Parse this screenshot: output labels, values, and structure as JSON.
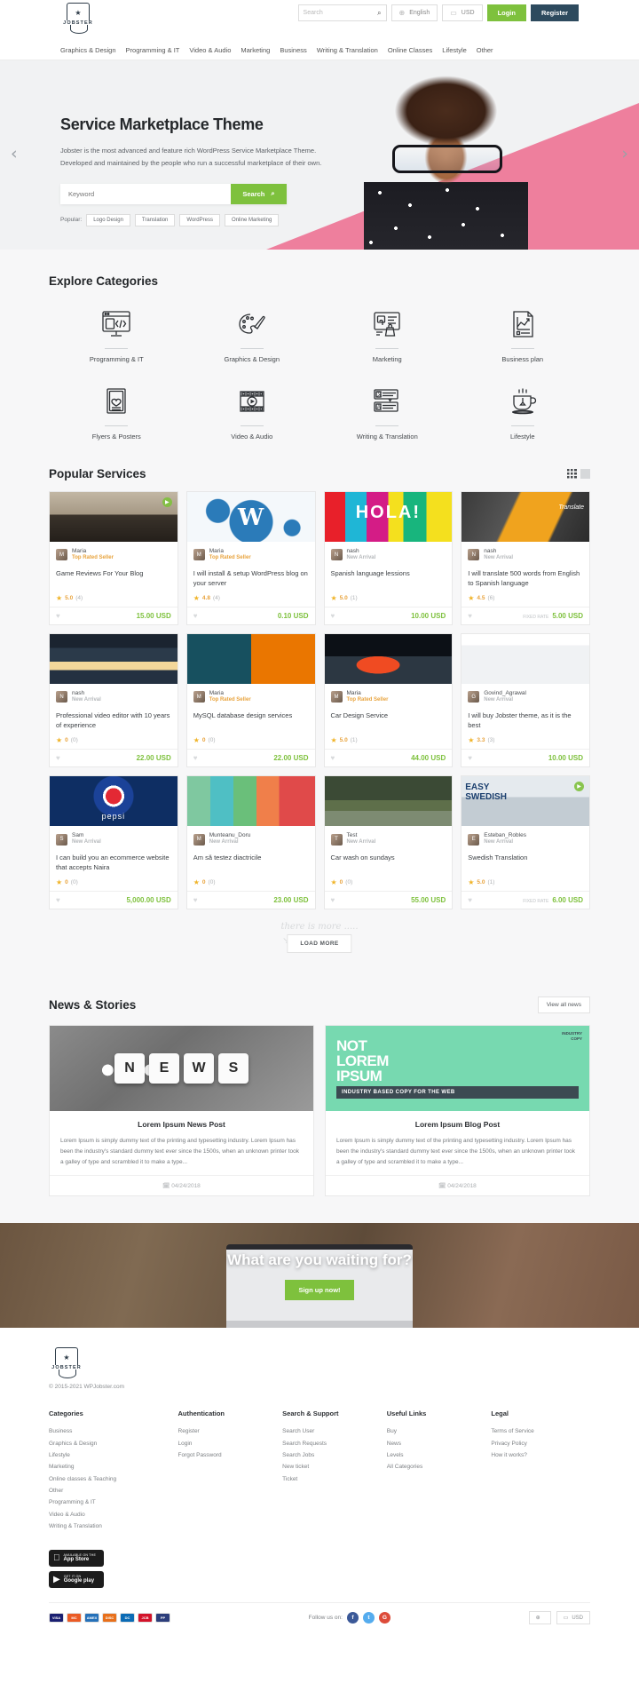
{
  "header": {
    "logo_text": "JOBSTER",
    "search_placeholder": "Search",
    "language": "English",
    "currency": "USD",
    "login_label": "Login",
    "register_label": "Register",
    "nav": [
      "Graphics & Design",
      "Programming & IT",
      "Video & Audio",
      "Marketing",
      "Business",
      "Writing & Translation",
      "Online Classes",
      "Lifestyle",
      "Other"
    ]
  },
  "hero": {
    "title": "Service Marketplace Theme",
    "subtitle_line1": "Jobster is the most advanced and feature rich WordPress Service Marketplace Theme.",
    "subtitle_line2": "Developed and maintained by the people who run a successful marketplace of their own.",
    "search_placeholder": "Keyword",
    "search_button": "Search",
    "popular_label": "Popular:",
    "popular_tags": [
      "Logo Design",
      "Translation",
      "WordPress",
      "Online Marketing"
    ],
    "prev_icon": "chevron-left",
    "next_icon": "chevron-right",
    "pink_color": "#ee7f9d"
  },
  "categories": {
    "title": "Explore Categories",
    "items": [
      {
        "label": "Programming & IT",
        "icon": "monitor-code-icon"
      },
      {
        "label": "Graphics & Design",
        "icon": "palette-brush-icon"
      },
      {
        "label": "Marketing",
        "icon": "marketing-screen-icon"
      },
      {
        "label": "Business plan",
        "icon": "chart-document-icon"
      },
      {
        "label": "Flyers & Posters",
        "icon": "poster-heart-icon"
      },
      {
        "label": "Video & Audio",
        "icon": "film-play-icon"
      },
      {
        "label": "Writing & Translation",
        "icon": "translate-icon"
      },
      {
        "label": "Lifestyle",
        "icon": "teacup-icon"
      }
    ]
  },
  "services": {
    "title": "Popular Services",
    "view_grid_icon": "grid-view-icon",
    "view_list_icon": "list-view-icon",
    "load_more_label": "LOAD MORE",
    "more_script_text": "there is more .....",
    "cards": [
      {
        "seller": "Maria",
        "badge": "Top Rated Seller",
        "badge_type": "top",
        "title": "Game Reviews For Your Blog",
        "rating": "5.0",
        "reviews": "(4)",
        "price": "15.00 USD",
        "fixed_rate": "",
        "image": "game-landscape",
        "has_play": true
      },
      {
        "seller": "Maria",
        "badge": "Top Rated Seller",
        "badge_type": "top",
        "title": "I will install & setup WordPress blog on your server",
        "rating": "4.8",
        "reviews": "(4)",
        "price": "0.10 USD",
        "fixed_rate": "",
        "image": "wordpress-gears",
        "has_play": false
      },
      {
        "seller": "nash",
        "badge": "New Arrival",
        "badge_type": "new",
        "title": "Spanish language lessions",
        "rating": "5.0",
        "reviews": "(1)",
        "price": "10.00 USD",
        "fixed_rate": "",
        "image": "hola-letters",
        "has_play": false
      },
      {
        "seller": "nash",
        "badge": "New Arrival",
        "badge_type": "new",
        "title": "I will translate 500 words from English to Spanish language",
        "rating": "4.5",
        "reviews": "(6)",
        "price": "5.00 USD",
        "fixed_rate": "FIXED RATE",
        "image": "translate-key",
        "has_play": false
      },
      {
        "seller": "nash",
        "badge": "New Arrival",
        "badge_type": "new",
        "title": "Professional video editor with 10 years of experience",
        "rating": "0",
        "reviews": "(0)",
        "price": "22.00 USD",
        "fixed_rate": "",
        "image": "video-timeline",
        "has_play": false
      },
      {
        "seller": "Maria",
        "badge": "Top Rated Seller",
        "badge_type": "top",
        "title": "MySQL database design services",
        "rating": "0",
        "reviews": "(0)",
        "price": "22.00 USD",
        "fixed_rate": "",
        "image": "mysql-dolphin",
        "has_play": false
      },
      {
        "seller": "Maria",
        "badge": "Top Rated Seller",
        "badge_type": "top",
        "title": "Car Design Service",
        "rating": "5.0",
        "reviews": "(1)",
        "price": "44.00 USD",
        "fixed_rate": "",
        "image": "orange-car",
        "has_play": false
      },
      {
        "seller": "Govind_Agrawal",
        "badge": "New Arrival",
        "badge_type": "new",
        "title": "I will buy Jobster theme, as it is the best",
        "rating": "3.3",
        "reviews": "(3)",
        "price": "10.00 USD",
        "fixed_rate": "",
        "image": "service-chart",
        "has_play": false
      },
      {
        "seller": "Sam",
        "badge": "New Arrival",
        "badge_type": "new",
        "title": "I can build you an ecommerce website that accepts Naira",
        "rating": "0",
        "reviews": "(0)",
        "price": "5,000.00 USD",
        "fixed_rate": "",
        "image": "pepsi-logo",
        "has_play": false
      },
      {
        "seller": "Munteanu_Doru",
        "badge": "New Arrival",
        "badge_type": "new",
        "title": "Am să testez diactricile",
        "rating": "0",
        "reviews": "(0)",
        "price": "23.00 USD",
        "fixed_rate": "",
        "image": "robots",
        "has_play": false
      },
      {
        "seller": "Test",
        "badge": "New Arrival",
        "badge_type": "new",
        "title": "Car wash on sundays",
        "rating": "0",
        "reviews": "(0)",
        "price": "55.00 USD",
        "fixed_rate": "",
        "image": "flood-field",
        "has_play": false
      },
      {
        "seller": "Esteban_Robles",
        "badge": "New Arrival",
        "badge_type": "new",
        "title": "Swedish Translation",
        "rating": "5.0",
        "reviews": "(1)",
        "price": "6.00 USD",
        "fixed_rate": "FIXED RATE",
        "image": "easy-swedish",
        "has_play": true
      }
    ]
  },
  "news": {
    "title": "News & Stories",
    "view_all_label": "View all news",
    "posts": [
      {
        "title": "Lorem Ipsum News Post",
        "excerpt": "Lorem Ipsum is simply dummy text of the printing and typesetting industry. Lorem Ipsum has been the industry's standard dummy text ever since the 1500s, when an unknown printer took a galley of type and scrambled it to make a type...",
        "date": "04/24/2018",
        "image": "news-dice",
        "dice": [
          "N",
          "E",
          "W",
          "S"
        ]
      },
      {
        "title": "Lorem Ipsum Blog Post",
        "excerpt": "Lorem Ipsum is simply dummy text of the printing and typesetting industry. Lorem Ipsum has been the industry's standard dummy text ever since the 1500s, when an unknown printer took a galley of type and scrambled it to make a type...",
        "date": "04/24/2018",
        "image": "not-lorem-ipsum",
        "overlay_line1": "NOT",
        "overlay_line2": "LOREM",
        "overlay_line3": "IPSUM",
        "overlay_banner": "INDUSTRY BASED COPY FOR THE WEB",
        "corner_badge": "INDUSTRY\nCOPY"
      }
    ]
  },
  "cta": {
    "title": "What are you waiting for?",
    "button_label": "Sign up now!"
  },
  "footer": {
    "logo_text": "JOBSTER",
    "copyright": "© 2015-2021 WPJobster.com",
    "columns": [
      {
        "title": "Categories",
        "items": [
          "Business",
          "Graphics & Design",
          "Lifestyle",
          "Marketing",
          "Online classes & Teaching",
          "Other",
          "Programming & IT",
          "Video & Audio",
          "Writing & Translation"
        ]
      },
      {
        "title": "Authentication",
        "items": [
          "Register",
          "Login",
          "Forgot Password"
        ]
      },
      {
        "title": "Search & Support",
        "items": [
          "Search User",
          "Search Requests",
          "Search Jobs",
          "New ticket",
          "Ticket"
        ]
      },
      {
        "title": "Useful Links",
        "items": [
          "Buy",
          "News",
          "Levels",
          "All Categories"
        ]
      },
      {
        "title": "Legal",
        "items": [
          "Terms of Service",
          "Privacy Policy",
          "How it works?"
        ]
      }
    ],
    "stores": [
      {
        "small": "AVAILABLE ON THE",
        "big": "App Store",
        "icon": "apple-icon"
      },
      {
        "small": "GET IT ON",
        "big": "Google play",
        "icon": "play-store-icon"
      }
    ],
    "payment_cards": [
      "VISA",
      "MC",
      "AMEX",
      "DISC",
      "DC",
      "JCB",
      "PP"
    ],
    "follow_label": "Follow us on:",
    "socials": [
      {
        "name": "facebook-icon",
        "glyph": "f",
        "color": "#3b5998"
      },
      {
        "name": "twitter-icon",
        "glyph": "t",
        "color": "#55acee"
      },
      {
        "name": "google-icon",
        "glyph": "G",
        "color": "#dd4b39"
      }
    ],
    "language": "",
    "currency": "USD"
  }
}
